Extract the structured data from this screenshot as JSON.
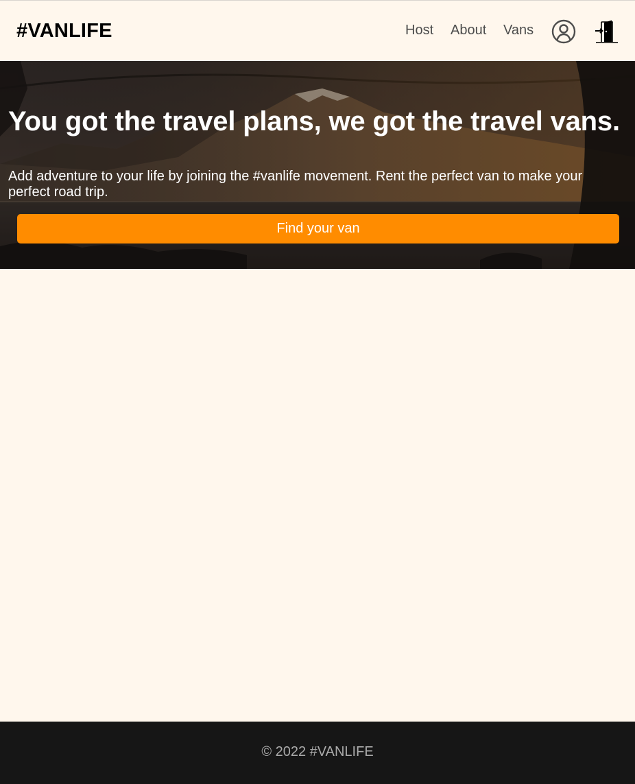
{
  "header": {
    "logo": "#VANLIFE",
    "nav": {
      "host": "Host",
      "about": "About",
      "vans": "Vans"
    },
    "icons": {
      "account": "user-circle-icon",
      "logout": "door-exit-icon"
    }
  },
  "hero": {
    "title": "You got the travel plans, we got the travel vans.",
    "subtitle": "Add adventure to your life by joining the #vanlife movement. Rent the perfect van to make your perfect road trip.",
    "cta_label": "Find your van"
  },
  "footer": {
    "copyright": "© 2022 #VANLIFE"
  },
  "colors": {
    "page_background": "#FFF7ED",
    "accent": "#FF8C00",
    "footer_background": "#161616",
    "footer_text": "#AAAAAA",
    "nav_text": "#4D4D4D"
  }
}
